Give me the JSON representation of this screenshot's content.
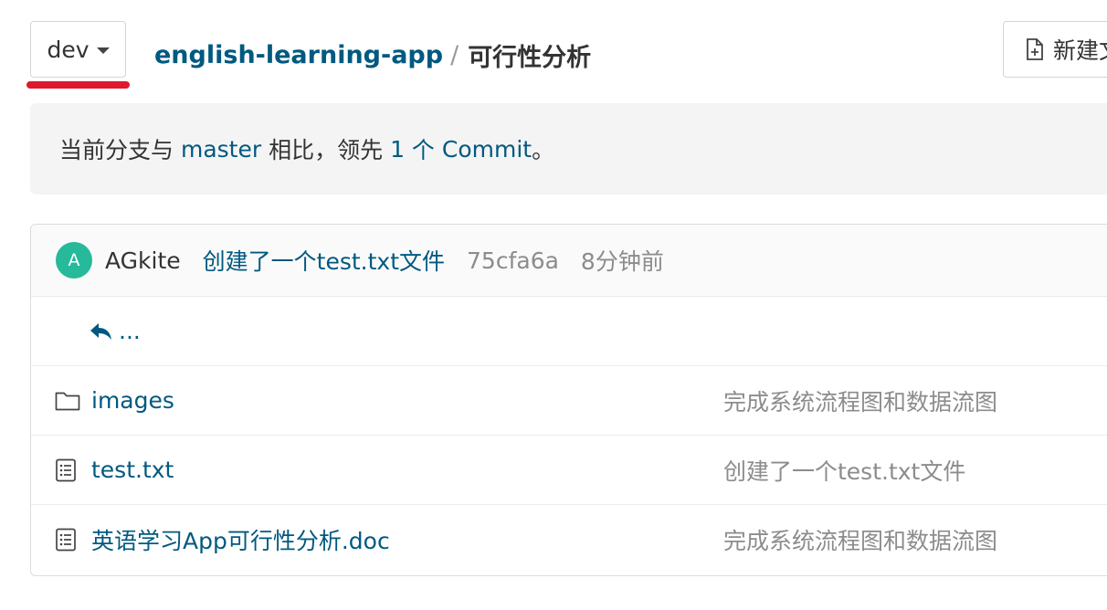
{
  "branch": {
    "name": "dev"
  },
  "breadcrumb": {
    "repo": "english-learning-app",
    "separator": "/",
    "current": "可行性分析"
  },
  "toolbar": {
    "new_button_label": "新建文"
  },
  "compare": {
    "prefix": "当前分支与",
    "base_branch": "master",
    "middle": "相比，领先",
    "count": "1",
    "unit": "个",
    "commit_word": "Commit",
    "suffix": "。"
  },
  "last_commit": {
    "avatar_letter": "A",
    "avatar_color": "#26b99a",
    "author": "AGkite",
    "message": "创建了一个test.txt文件",
    "hash": "75cfa6a",
    "time": "8分钟前"
  },
  "parent_dir": {
    "label": "..."
  },
  "files": [
    {
      "icon": "folder-icon",
      "name": "images",
      "commit": "完成系统流程图和数据流图"
    },
    {
      "icon": "file-text-icon",
      "name": "test.txt",
      "commit": "创建了一个test.txt文件"
    },
    {
      "icon": "file-text-icon",
      "name": "英语学习App可行性分析.doc",
      "commit": "完成系统流程图和数据流图"
    }
  ],
  "colors": {
    "link": "#005980",
    "highlight_underline": "#e0182d",
    "muted_text": "#8c8c8c"
  }
}
